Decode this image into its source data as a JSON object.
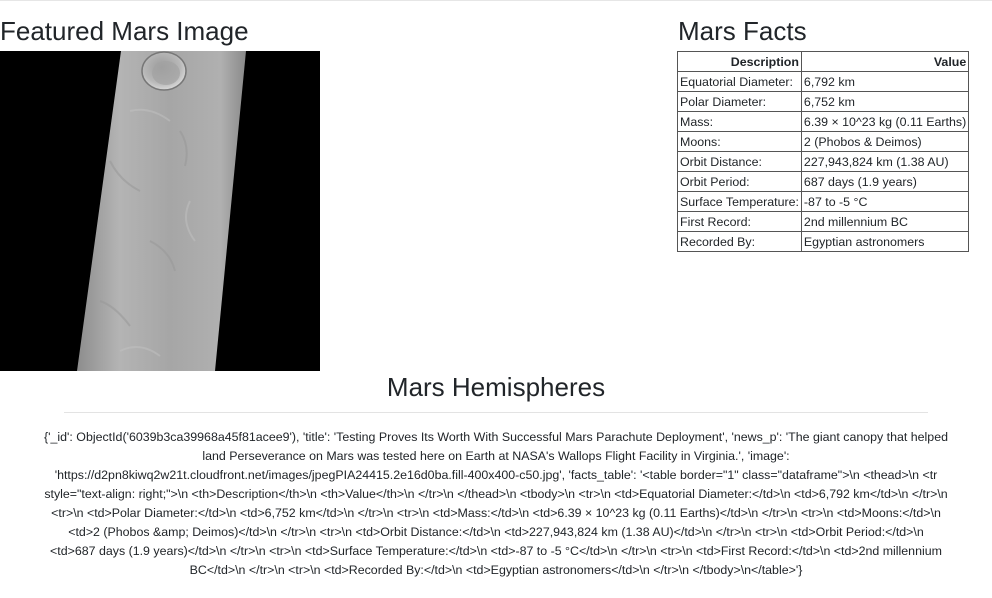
{
  "featured": {
    "title": "Featured Mars Image"
  },
  "facts": {
    "title": "Mars Facts",
    "headers": [
      "Description",
      "Value"
    ],
    "rows": [
      [
        "Equatorial Diameter:",
        "6,792 km"
      ],
      [
        "Polar Diameter:",
        "6,752 km"
      ],
      [
        "Mass:",
        "6.39 × 10^23 kg (0.11 Earths)"
      ],
      [
        "Moons:",
        "2 (Phobos & Deimos)"
      ],
      [
        "Orbit Distance:",
        "227,943,824 km (1.38 AU)"
      ],
      [
        "Orbit Period:",
        "687 days (1.9 years)"
      ],
      [
        "Surface Temperature:",
        "-87 to -5 °C"
      ],
      [
        "First Record:",
        "2nd millennium BC"
      ],
      [
        "Recorded By:",
        "Egyptian astronomers"
      ]
    ]
  },
  "hemispheres": {
    "title": "Mars Hemispheres",
    "raw_text": "{'_id': ObjectId('6039b3ca39968a45f81acee9'), 'title': 'Testing Proves Its Worth With Successful Mars Parachute Deployment', 'news_p': 'The giant canopy that helped land Perseverance on Mars was tested here on Earth at NASA's Wallops Flight Facility in Virginia.', 'image': 'https://d2pn8kiwq2w21t.cloudfront.net/images/jpegPIA24415.2e16d0ba.fill-400x400-c50.jpg', 'facts_table': '<table border=\"1\" class=\"dataframe\">\\n <thead>\\n <tr style=\"text-align: right;\">\\n <th>Description</th>\\n <th>Value</th>\\n </tr>\\n </thead>\\n <tbody>\\n <tr>\\n <td>Equatorial Diameter:</td>\\n <td>6,792 km</td>\\n </tr>\\n <tr>\\n <td>Polar Diameter:</td>\\n <td>6,752 km</td>\\n </tr>\\n <tr>\\n <td>Mass:</td>\\n <td>6.39 × 10^23 kg (0.11 Earths)</td>\\n </tr>\\n <tr>\\n <td>Moons:</td>\\n <td>2 (Phobos &amp; Deimos)</td>\\n </tr>\\n <tr>\\n <td>Orbit Distance:</td>\\n <td>227,943,824 km (1.38 AU)</td>\\n </tr>\\n <tr>\\n <td>Orbit Period:</td>\\n <td>687 days (1.9 years)</td>\\n </tr>\\n <tr>\\n <td>Surface Temperature:</td>\\n <td>-87 to -5 °C</td>\\n </tr>\\n <tr>\\n <td>First Record:</td>\\n <td>2nd millennium BC</td>\\n </tr>\\n <tr>\\n <td>Recorded By:</td>\\n <td>Egyptian astronomers</td>\\n </tr>\\n </tbody>\\n</table>'}"
  },
  "colors": {
    "image_background": "#000000",
    "strip_surface": "#a9a9a9"
  }
}
